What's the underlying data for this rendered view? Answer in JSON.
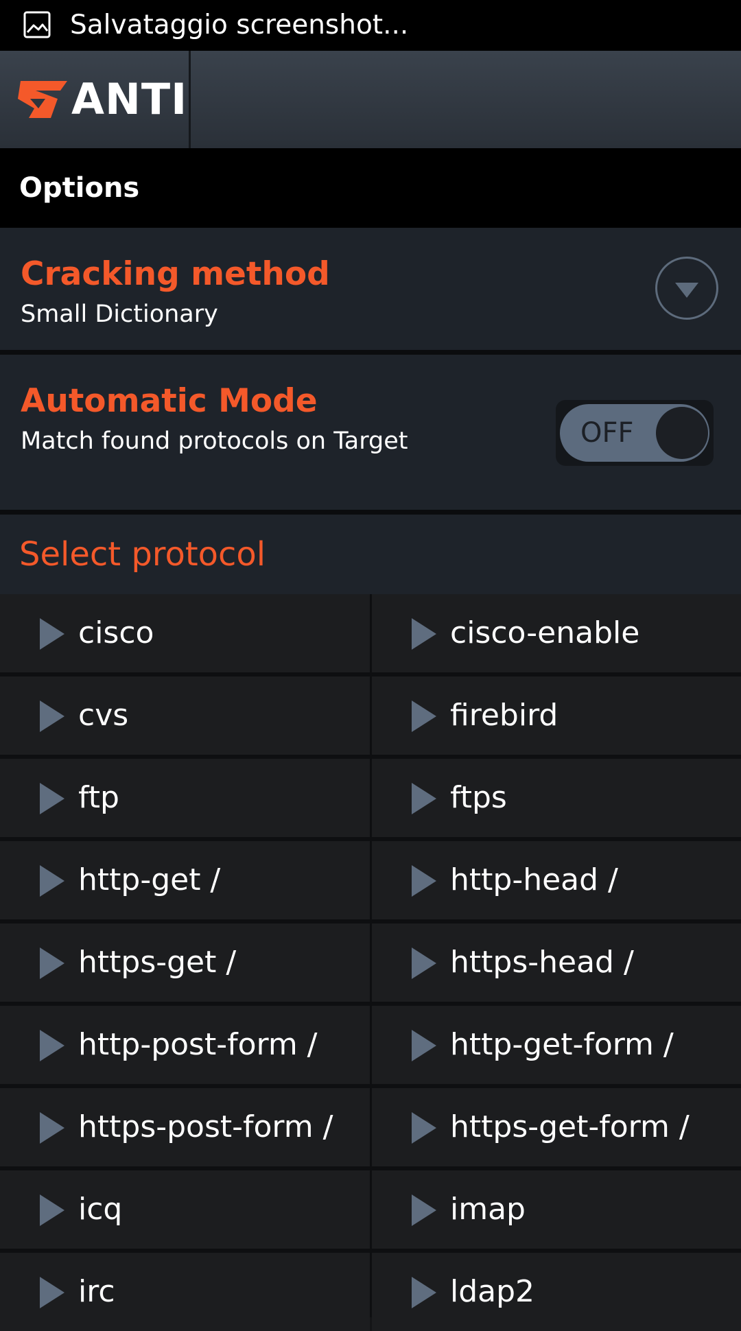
{
  "status_bar": {
    "text": "Salvataggio screenshot...",
    "icon": "image-icon"
  },
  "action_bar": {
    "app_name": "ANTI",
    "logo_icon": "anti-logo-icon",
    "brand_color": "#f4592a"
  },
  "options": {
    "title": "Options",
    "cracking_method": {
      "label": "Cracking method",
      "value": "Small Dictionary",
      "control_icon": "chevron-down-icon"
    },
    "automatic_mode": {
      "label": "Automatic Mode",
      "description": "Match found protocols on Target",
      "toggle_state": "OFF"
    }
  },
  "protocols": {
    "title": "Select protocol",
    "item_icon": "play-triangle-icon",
    "items": [
      "cisco",
      "cisco-enable",
      "cvs",
      "firebird",
      "ftp",
      "ftps",
      "http-get /",
      "http-head /",
      "https-get /",
      "https-head /",
      "http-post-form /",
      "http-get-form /",
      "https-post-form /",
      "https-get-form /",
      "icq",
      "imap",
      "irc",
      "ldap2"
    ]
  }
}
